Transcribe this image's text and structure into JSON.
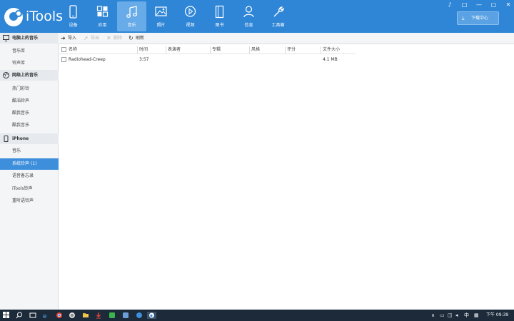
{
  "app": {
    "name": "iTools"
  },
  "nav": [
    {
      "label": "设备",
      "icon": "phone-icon"
    },
    {
      "label": "应用",
      "icon": "apps-grid-icon"
    },
    {
      "label": "音乐",
      "icon": "music-note-icon"
    },
    {
      "label": "照片",
      "icon": "photo-icon"
    },
    {
      "label": "视频",
      "icon": "play-video-icon"
    },
    {
      "label": "图书",
      "icon": "book-icon"
    },
    {
      "label": "信息",
      "icon": "person-icon"
    },
    {
      "label": "工具箱",
      "icon": "wrench-icon"
    }
  ],
  "active_nav": "音乐",
  "window_controls": [
    "♪",
    "□",
    "—",
    "▢",
    "✕"
  ],
  "download_center": {
    "label": "下载中心",
    "icon": "download-icon"
  },
  "sidebar": {
    "pc_section": {
      "title": "电脑上的音乐",
      "icon": "monitor-icon",
      "items": [
        "音乐库",
        "铃声库"
      ]
    },
    "online_section": {
      "title": "网络上的音乐",
      "icon": "globe-icon",
      "items": [
        "热门彩铃",
        "酷滔铃声",
        "酷我音乐",
        "酷我音乐"
      ]
    },
    "device_section": {
      "title": "iPhone",
      "icon": "device-icon",
      "items": [
        "音乐",
        "系统铃声 (1)",
        "语音备忘录",
        "iTools铃声",
        "重听语铃声"
      ]
    },
    "active_item": "系统铃声 (1)"
  },
  "toolbar": {
    "import": "导入",
    "export": "导出",
    "delete": "删除",
    "refresh": "刷新"
  },
  "table": {
    "columns": [
      "名称",
      "时间",
      "表演者",
      "专辑",
      "风格",
      "评分",
      "文件大小"
    ],
    "rows": [
      {
        "name": "Radiohead-Creep",
        "time": "3:57",
        "artist": "",
        "album": "",
        "genre": "",
        "rating": "",
        "size": "4.1 MB"
      }
    ]
  },
  "taskbar": {
    "clock": "下午 09:39",
    "ime": "中"
  },
  "colors": {
    "header": "#2f86d6",
    "nav_active": "#67abe8",
    "sidebar_active": "#3d8fdb",
    "taskbar": "#1c2a3a"
  }
}
